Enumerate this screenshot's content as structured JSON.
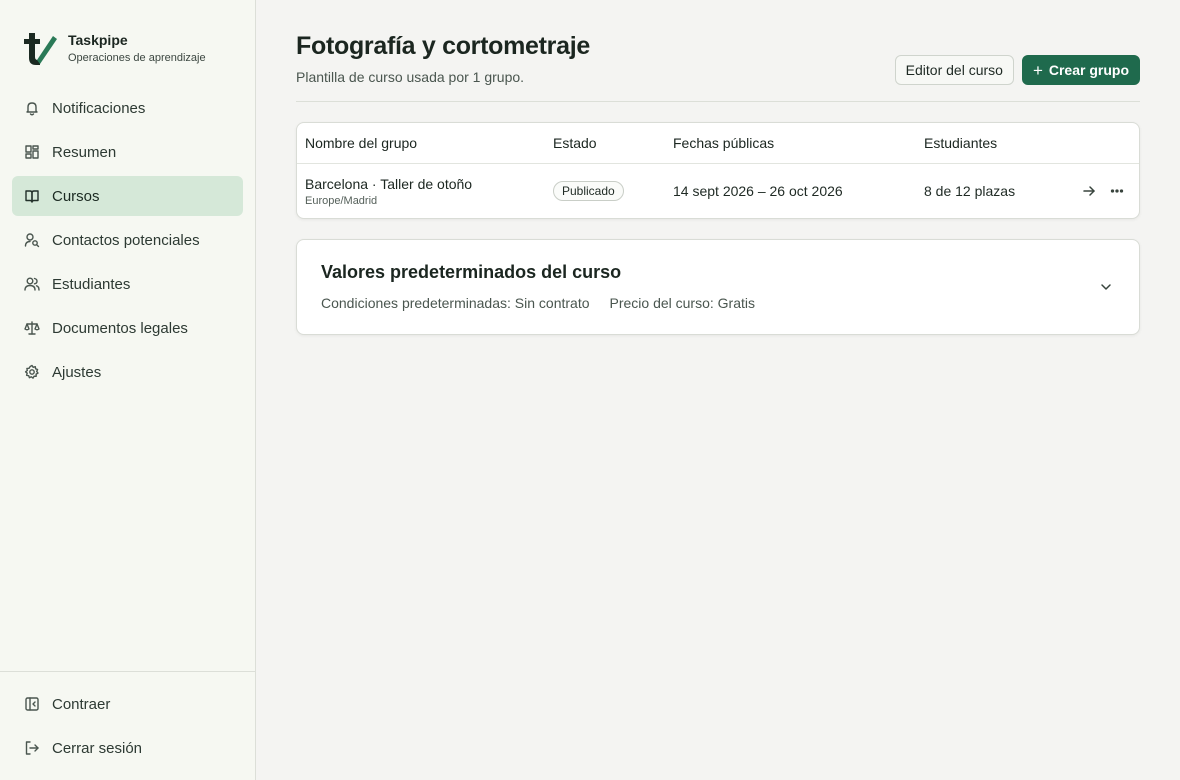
{
  "brand": {
    "name": "Taskpipe",
    "subtitle": "Operaciones de aprendizaje",
    "color": "#1f6a4d"
  },
  "sidebar": {
    "items": [
      {
        "label": "Notificaciones",
        "icon": "bell-icon",
        "active": false
      },
      {
        "label": "Resumen",
        "icon": "dashboard-icon",
        "active": false
      },
      {
        "label": "Cursos",
        "icon": "book-icon",
        "active": true
      },
      {
        "label": "Contactos potenciales",
        "icon": "user-search-icon",
        "active": false
      },
      {
        "label": "Estudiantes",
        "icon": "users-icon",
        "active": false
      },
      {
        "label": "Documentos legales",
        "icon": "scale-icon",
        "active": false
      },
      {
        "label": "Ajustes",
        "icon": "gear-icon",
        "active": false
      }
    ],
    "bottom": [
      {
        "label": "Contraer",
        "icon": "collapse-icon"
      },
      {
        "label": "Cerrar sesión",
        "icon": "logout-icon"
      }
    ]
  },
  "page": {
    "title": "Fotografía y cortometraje",
    "subtitle": "Plantilla de curso usada por 1 grupo.",
    "editor_button": "Editor del curso",
    "create_button": "Crear grupo"
  },
  "table": {
    "columns": [
      "Nombre del grupo",
      "Estado",
      "Fechas públicas",
      "Estudiantes"
    ],
    "rows": [
      {
        "name": "Barcelona · Taller de otoño",
        "timezone": "Europe/Madrid",
        "status": "Publicado",
        "dates": "14 sept 2026 – 26 oct 2026",
        "students": "8 de 12 plazas"
      }
    ]
  },
  "defaults": {
    "title": "Valores predeterminados del curso",
    "conditions": "Condiciones predeterminadas: Sin contrato",
    "price": "Precio del curso: Gratis"
  }
}
